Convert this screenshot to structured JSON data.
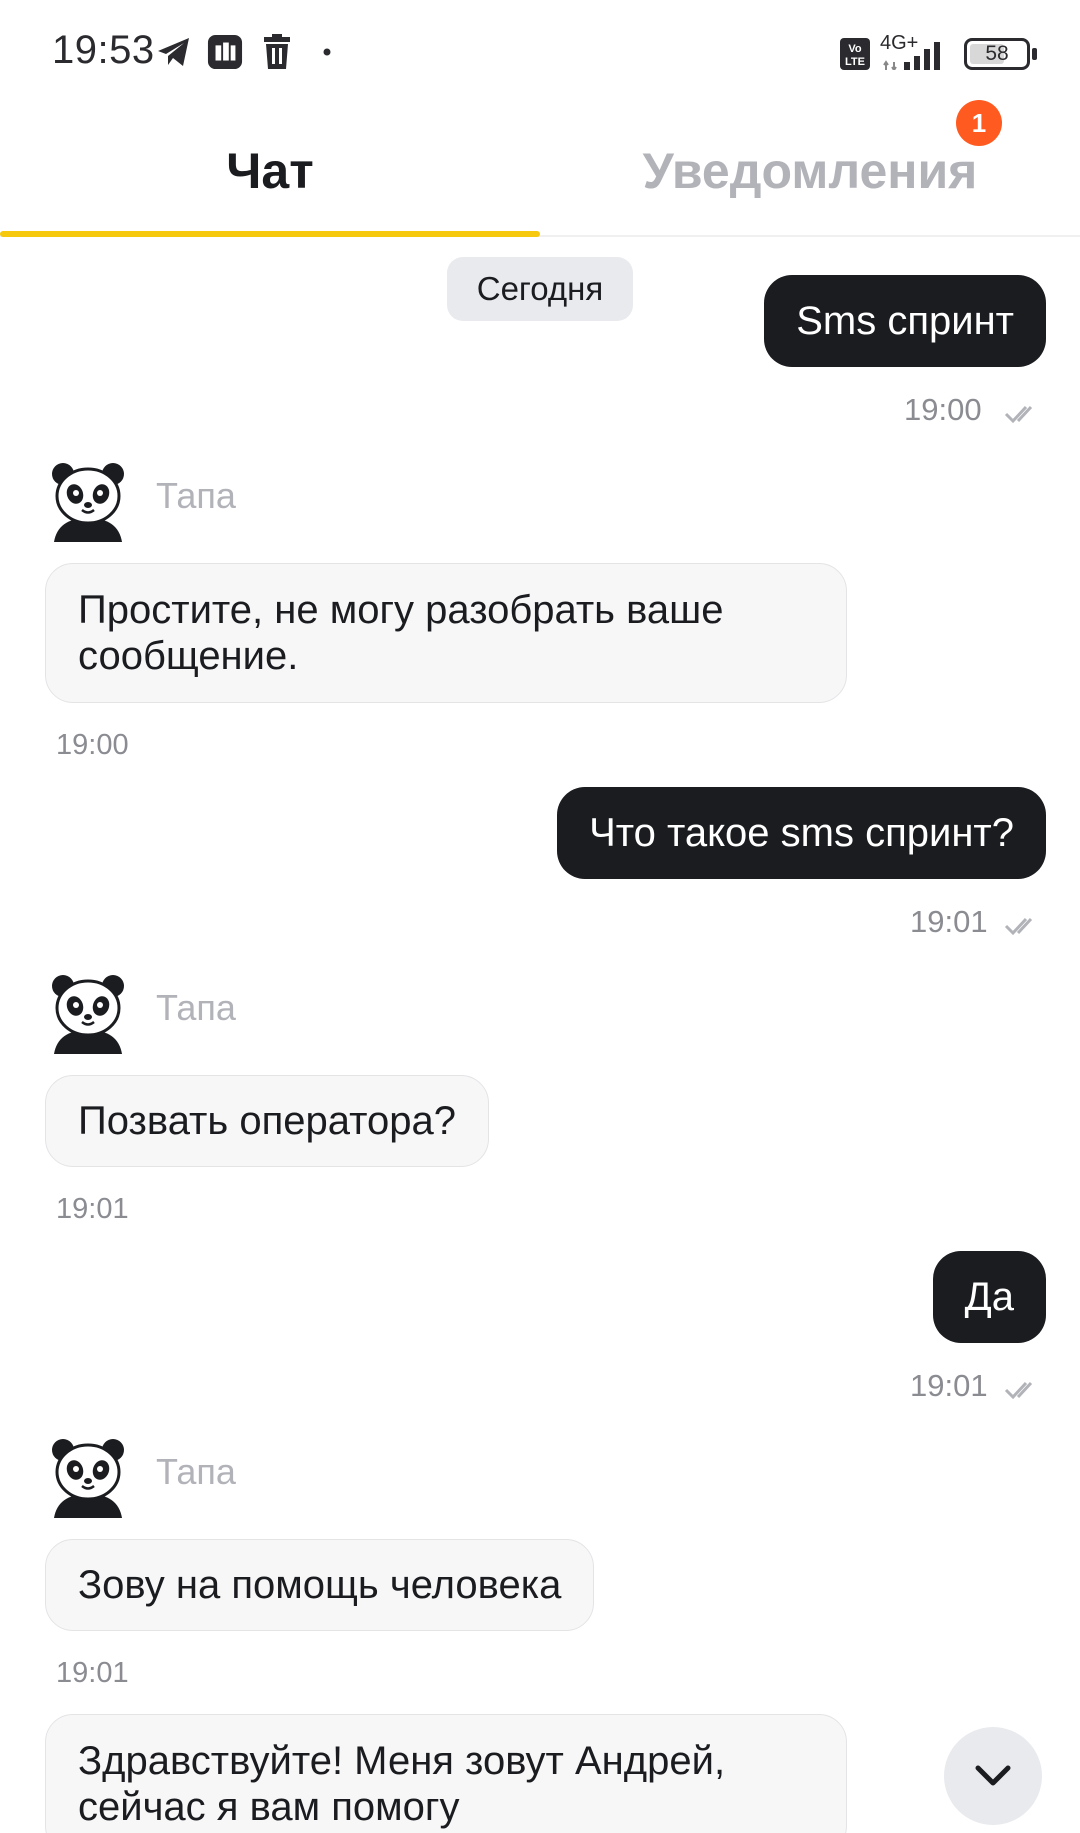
{
  "status_bar": {
    "time": "19:53",
    "network": "4G+",
    "volte": "Vo LTE",
    "battery": "58",
    "icons": [
      "telegram-icon",
      "app-icon",
      "trash-icon",
      "dot-icon"
    ]
  },
  "tabs": {
    "chat_label": "Чат",
    "notifications_label": "Уведомления",
    "notifications_badge": "1",
    "accent_color": "#f6c90e"
  },
  "chat": {
    "date_label": "Сегодня",
    "bot_name": "Тапа",
    "messages": [
      {
        "direction": "out",
        "text": "Sms спринт",
        "time": "19:00"
      },
      {
        "direction": "in",
        "sender": "Тапа",
        "text": "Простите, не могу разобрать ваше сообщение.",
        "time": "19:00"
      },
      {
        "direction": "out",
        "text": "Что такое sms спринт?",
        "time": "19:01"
      },
      {
        "direction": "in",
        "sender": "Тапа",
        "text": "Позвать оператора?",
        "time": "19:01"
      },
      {
        "direction": "out",
        "text": "Да",
        "time": "19:01"
      },
      {
        "direction": "in",
        "sender": "Тапа",
        "text": "Зову на помощь человека",
        "time": "19:01"
      },
      {
        "direction": "in",
        "text": "Здравствуйте! Меня зовут Андрей, сейчас я вам помогу",
        "time": ""
      }
    ]
  }
}
